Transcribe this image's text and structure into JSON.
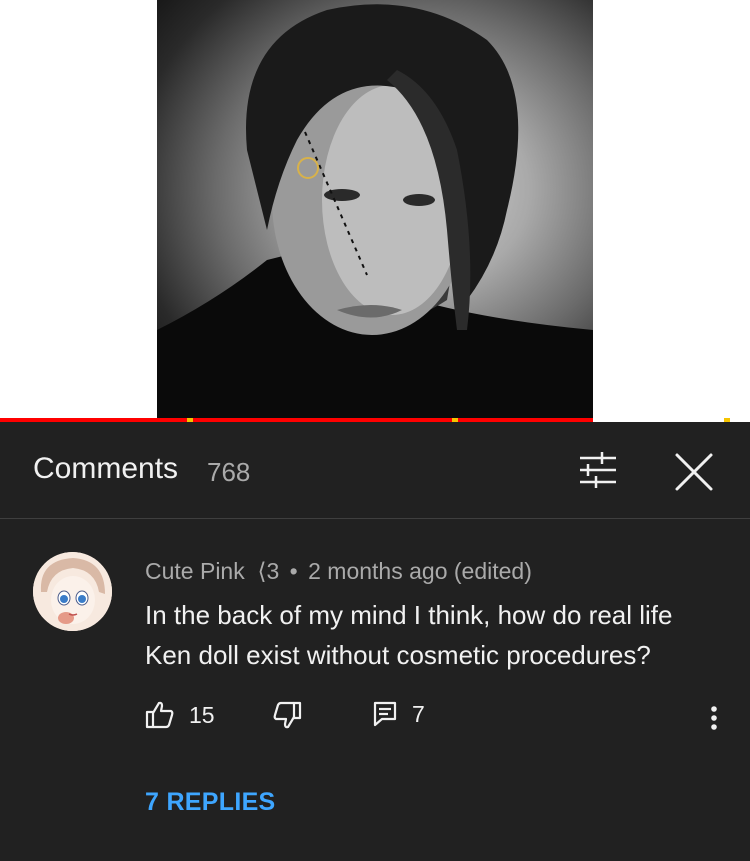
{
  "video": {
    "progress_fraction": 0.79,
    "progress_color": "#ff0000",
    "ad_marker_color": "#f5c400"
  },
  "comments_panel": {
    "title": "Comments",
    "count": "768",
    "filter_icon": "sort-sliders-icon",
    "close_icon": "close-icon"
  },
  "comment": {
    "author": "Cute Pink",
    "author_emoticon": "⟨3",
    "separator": "•",
    "time": "2 months ago (edited)",
    "text": "In the back of my mind I think, how do real life Ken doll exist without cosmetic procedures?",
    "likes": "15",
    "replies_count": "7",
    "like_icon": "thumbs-up-icon",
    "dislike_icon": "thumbs-down-icon",
    "reply_icon": "comment-reply-icon",
    "more_icon": "more-vertical-icon",
    "view_replies": "7 REPLIES",
    "accent": "#3ea6ff"
  }
}
